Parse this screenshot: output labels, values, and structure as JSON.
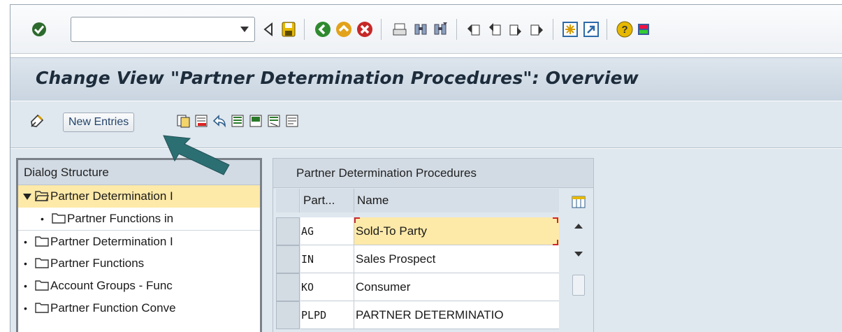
{
  "toolbar": {
    "command_field_value": "",
    "icons": [
      "checkmark-icon",
      "back-triangle-icon",
      "save-icon",
      "back-icon",
      "exit-icon",
      "cancel-icon",
      "print-icon",
      "find-icon",
      "find-next-icon",
      "first-page-icon",
      "previous-page-icon",
      "next-page-icon",
      "last-page-icon",
      "new-session-icon",
      "shortcut-icon",
      "help-icon",
      "customize-layout-icon"
    ]
  },
  "title": {
    "text": "Change View \"Partner Determination Procedures\": Overview"
  },
  "app_toolbar": {
    "new_entries_label": "New Entries",
    "icons": [
      "display-change-icon",
      "copy-icon",
      "delete-icon",
      "undo-icon",
      "select-all-icon",
      "select-block-icon",
      "deselect-all-icon",
      "details-icon"
    ]
  },
  "dialog_structure": {
    "header": "Dialog Structure",
    "items": [
      {
        "label": "Partner Determination Procedures",
        "shown": "Partner Determination I",
        "level": 0,
        "expanded": true,
        "selected": true
      },
      {
        "label": "Partner Functions in Procedure",
        "shown": "Partner Functions in",
        "level": 1
      },
      {
        "label": "Partner Determination Procedure Assignment",
        "shown": "Partner Determination I",
        "level": 0
      },
      {
        "label": "Partner Functions",
        "shown": "Partner Functions",
        "level": 0
      },
      {
        "label": "Account Groups - Function Assignment",
        "shown": "Account Groups - Func",
        "level": 0
      },
      {
        "label": "Partner Function Conversion",
        "shown": "Partner Function Conve",
        "level": 0
      }
    ]
  },
  "table": {
    "title": "Partner Determination Procedures",
    "columns": [
      "Part...",
      "Name"
    ],
    "rows": [
      {
        "code": "AG",
        "name": "Sold-To Party"
      },
      {
        "code": "IN",
        "name": "Sales Prospect"
      },
      {
        "code": "KO",
        "name": "Consumer"
      },
      {
        "code": "PLPD",
        "name": "PARTNER DETERMINATIO"
      }
    ]
  },
  "colors": {
    "title_band": "#c9d5e1",
    "selection": "#fde9a8",
    "annotation_arrow": "#2c6f73",
    "focus_marker": "#d2262b"
  }
}
